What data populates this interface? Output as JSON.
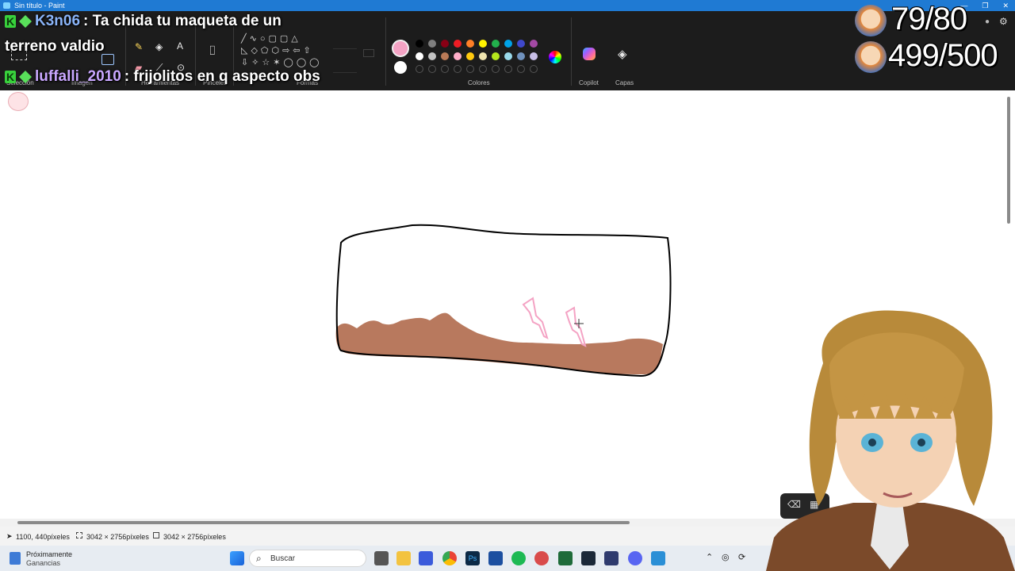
{
  "window": {
    "title": "Sin título - Paint",
    "controls": [
      "—",
      "❐",
      "✕"
    ]
  },
  "ribbon": {
    "groups": {
      "selection": "Selección",
      "image": "Imagen",
      "tools": "Herramientas",
      "brushes": "Pinceles",
      "shapes": "Formas",
      "colors": "Colores",
      "copilot": "Copilot",
      "layers": "Capas"
    },
    "primary_color": "#f4a3c4",
    "secondary_color": "#ffffff",
    "palette_row1": [
      "#000000",
      "#7f7f7f",
      "#880015",
      "#ed1c24",
      "#ff7f27",
      "#fff200",
      "#22b14c",
      "#00a2e8",
      "#3f48cc",
      "#a349a4"
    ],
    "palette_row2": [
      "#ffffff",
      "#c3c3c3",
      "#b97a57",
      "#ffaec9",
      "#ffc90e",
      "#efe4b0",
      "#b5e61d",
      "#99d9ea",
      "#7092be",
      "#c8bfe7"
    ]
  },
  "chat": {
    "messages": [
      {
        "user": "K3n06",
        "user_color": "#8ab4f8",
        "text": ": Ta chida tu maqueta de un",
        "text_line2": "terreno valdio"
      },
      {
        "user": "luffalli_2010",
        "user_color": "#c9a7ff",
        "text": ": frijolitos en q aspecto obs"
      }
    ]
  },
  "overlay": {
    "counter1": "79/80",
    "counter2": "499/500"
  },
  "statusbar": {
    "cursor_pos": "1100, 440píxeles",
    "selection_size": "3042 × 2756píxeles",
    "canvas_size": "3042 × 2756píxeles"
  },
  "taskbar": {
    "weather_title": "Próximamente",
    "weather_sub": "Ganancias",
    "search_placeholder": "Buscar"
  },
  "colors": {
    "dirt": "#b8795e",
    "lightning": "#f4a3c4",
    "titlebar": "#1f7ad3"
  }
}
